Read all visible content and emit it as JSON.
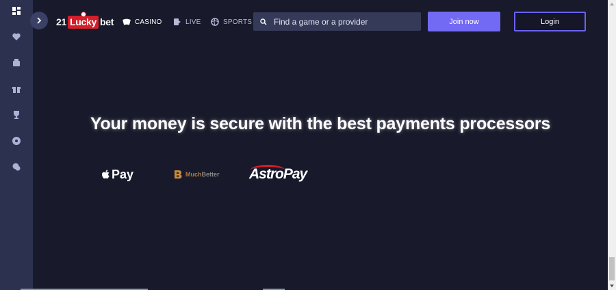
{
  "sidebar": {
    "items": [
      {
        "icon": "dashboard-icon",
        "active": true
      },
      {
        "icon": "heart-icon",
        "active": false
      },
      {
        "icon": "cashier-icon",
        "active": false
      },
      {
        "icon": "gift-icon",
        "active": false
      },
      {
        "icon": "trophy-icon",
        "active": false
      },
      {
        "icon": "wheel-icon",
        "active": false
      },
      {
        "icon": "chat-icon",
        "active": false
      }
    ]
  },
  "header": {
    "logo": {
      "part1": "21",
      "part2": "Lucky",
      "part3": "bet"
    },
    "nav": [
      {
        "label": "CASINO",
        "icon": "cards-icon"
      },
      {
        "label": "LIVE",
        "icon": "live-icon"
      },
      {
        "label": "SPORTS",
        "icon": "ball-icon"
      }
    ],
    "search": {
      "placeholder": "Find a game or a provider",
      "value": ""
    },
    "join_label": "Join now",
    "login_label": "Login"
  },
  "main": {
    "headline": "Your money is secure with the best payments processors",
    "payment_logos": {
      "applepay": "Pay",
      "muchbetter_much": "Much",
      "muchbetter_better": "Better",
      "astropay": "AstroPay"
    }
  },
  "colors": {
    "background": "#181a2b",
    "sidebar": "#2c3150",
    "accent": "#7269f5",
    "logo_red": "#d21f2a"
  }
}
